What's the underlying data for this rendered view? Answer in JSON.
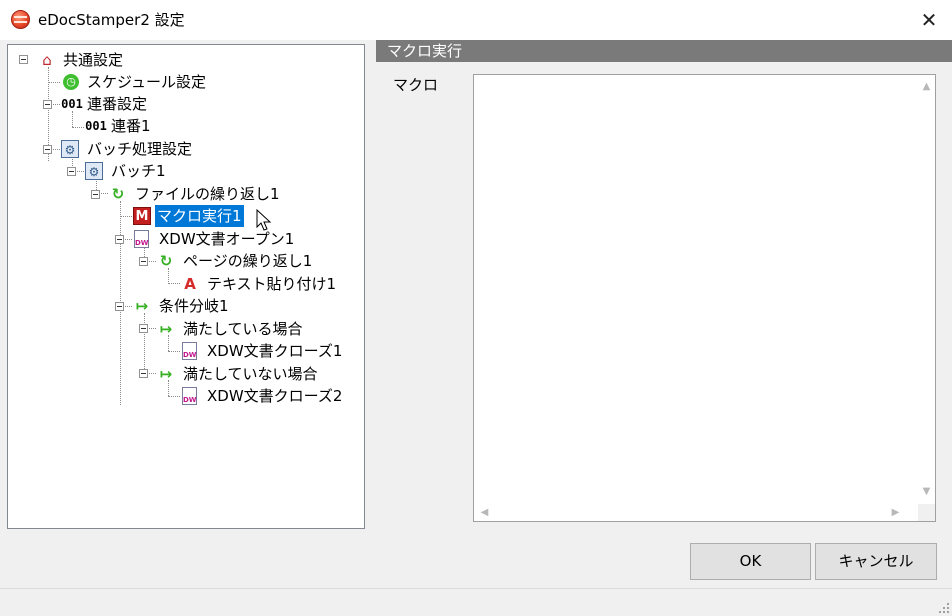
{
  "window": {
    "title": "eDocStamper2 設定",
    "close_glyph": "✕"
  },
  "tree": {
    "nodes": [
      {
        "label": "共通設定",
        "icon": "house-icon"
      },
      {
        "label": "スケジュール設定",
        "icon": "clock-icon"
      },
      {
        "label": "連番設定",
        "icon_text": "001"
      },
      {
        "label": "連番1",
        "icon_text": "001"
      },
      {
        "label": "バッチ処理設定",
        "icon": "gear-settings-icon"
      },
      {
        "label": "バッチ1",
        "icon": "gear-settings-icon"
      },
      {
        "label": "ファイルの繰り返し1",
        "icon": "loop-icon"
      },
      {
        "label": "マクロ実行1",
        "icon": "macro-icon",
        "selected": true,
        "icon_text": "M"
      },
      {
        "label": "XDW文書オープン1",
        "icon": "docuworks-icon",
        "icon_text": "DW"
      },
      {
        "label": "ページの繰り返し1",
        "icon": "loop-icon"
      },
      {
        "label": "テキスト貼り付け1",
        "icon": "text-stamp-icon",
        "icon_text": "A"
      },
      {
        "label": "条件分岐1",
        "icon": "branch-icon"
      },
      {
        "label": "満たしている場合",
        "icon": "branch-icon"
      },
      {
        "label": "XDW文書クローズ1",
        "icon": "docuworks-icon",
        "icon_text": "DW"
      },
      {
        "label": "満たしていない場合",
        "icon": "branch-icon"
      },
      {
        "label": "XDW文書クローズ2",
        "icon": "docuworks-icon",
        "icon_text": "DW"
      }
    ]
  },
  "properties": {
    "header": "マクロ実行",
    "macro_label": "マクロ",
    "macro_value": ""
  },
  "buttons": {
    "ok": "OK",
    "cancel": "キャンセル"
  },
  "colors": {
    "selection": "#0078d7",
    "header_bg": "#7a7a7a"
  }
}
